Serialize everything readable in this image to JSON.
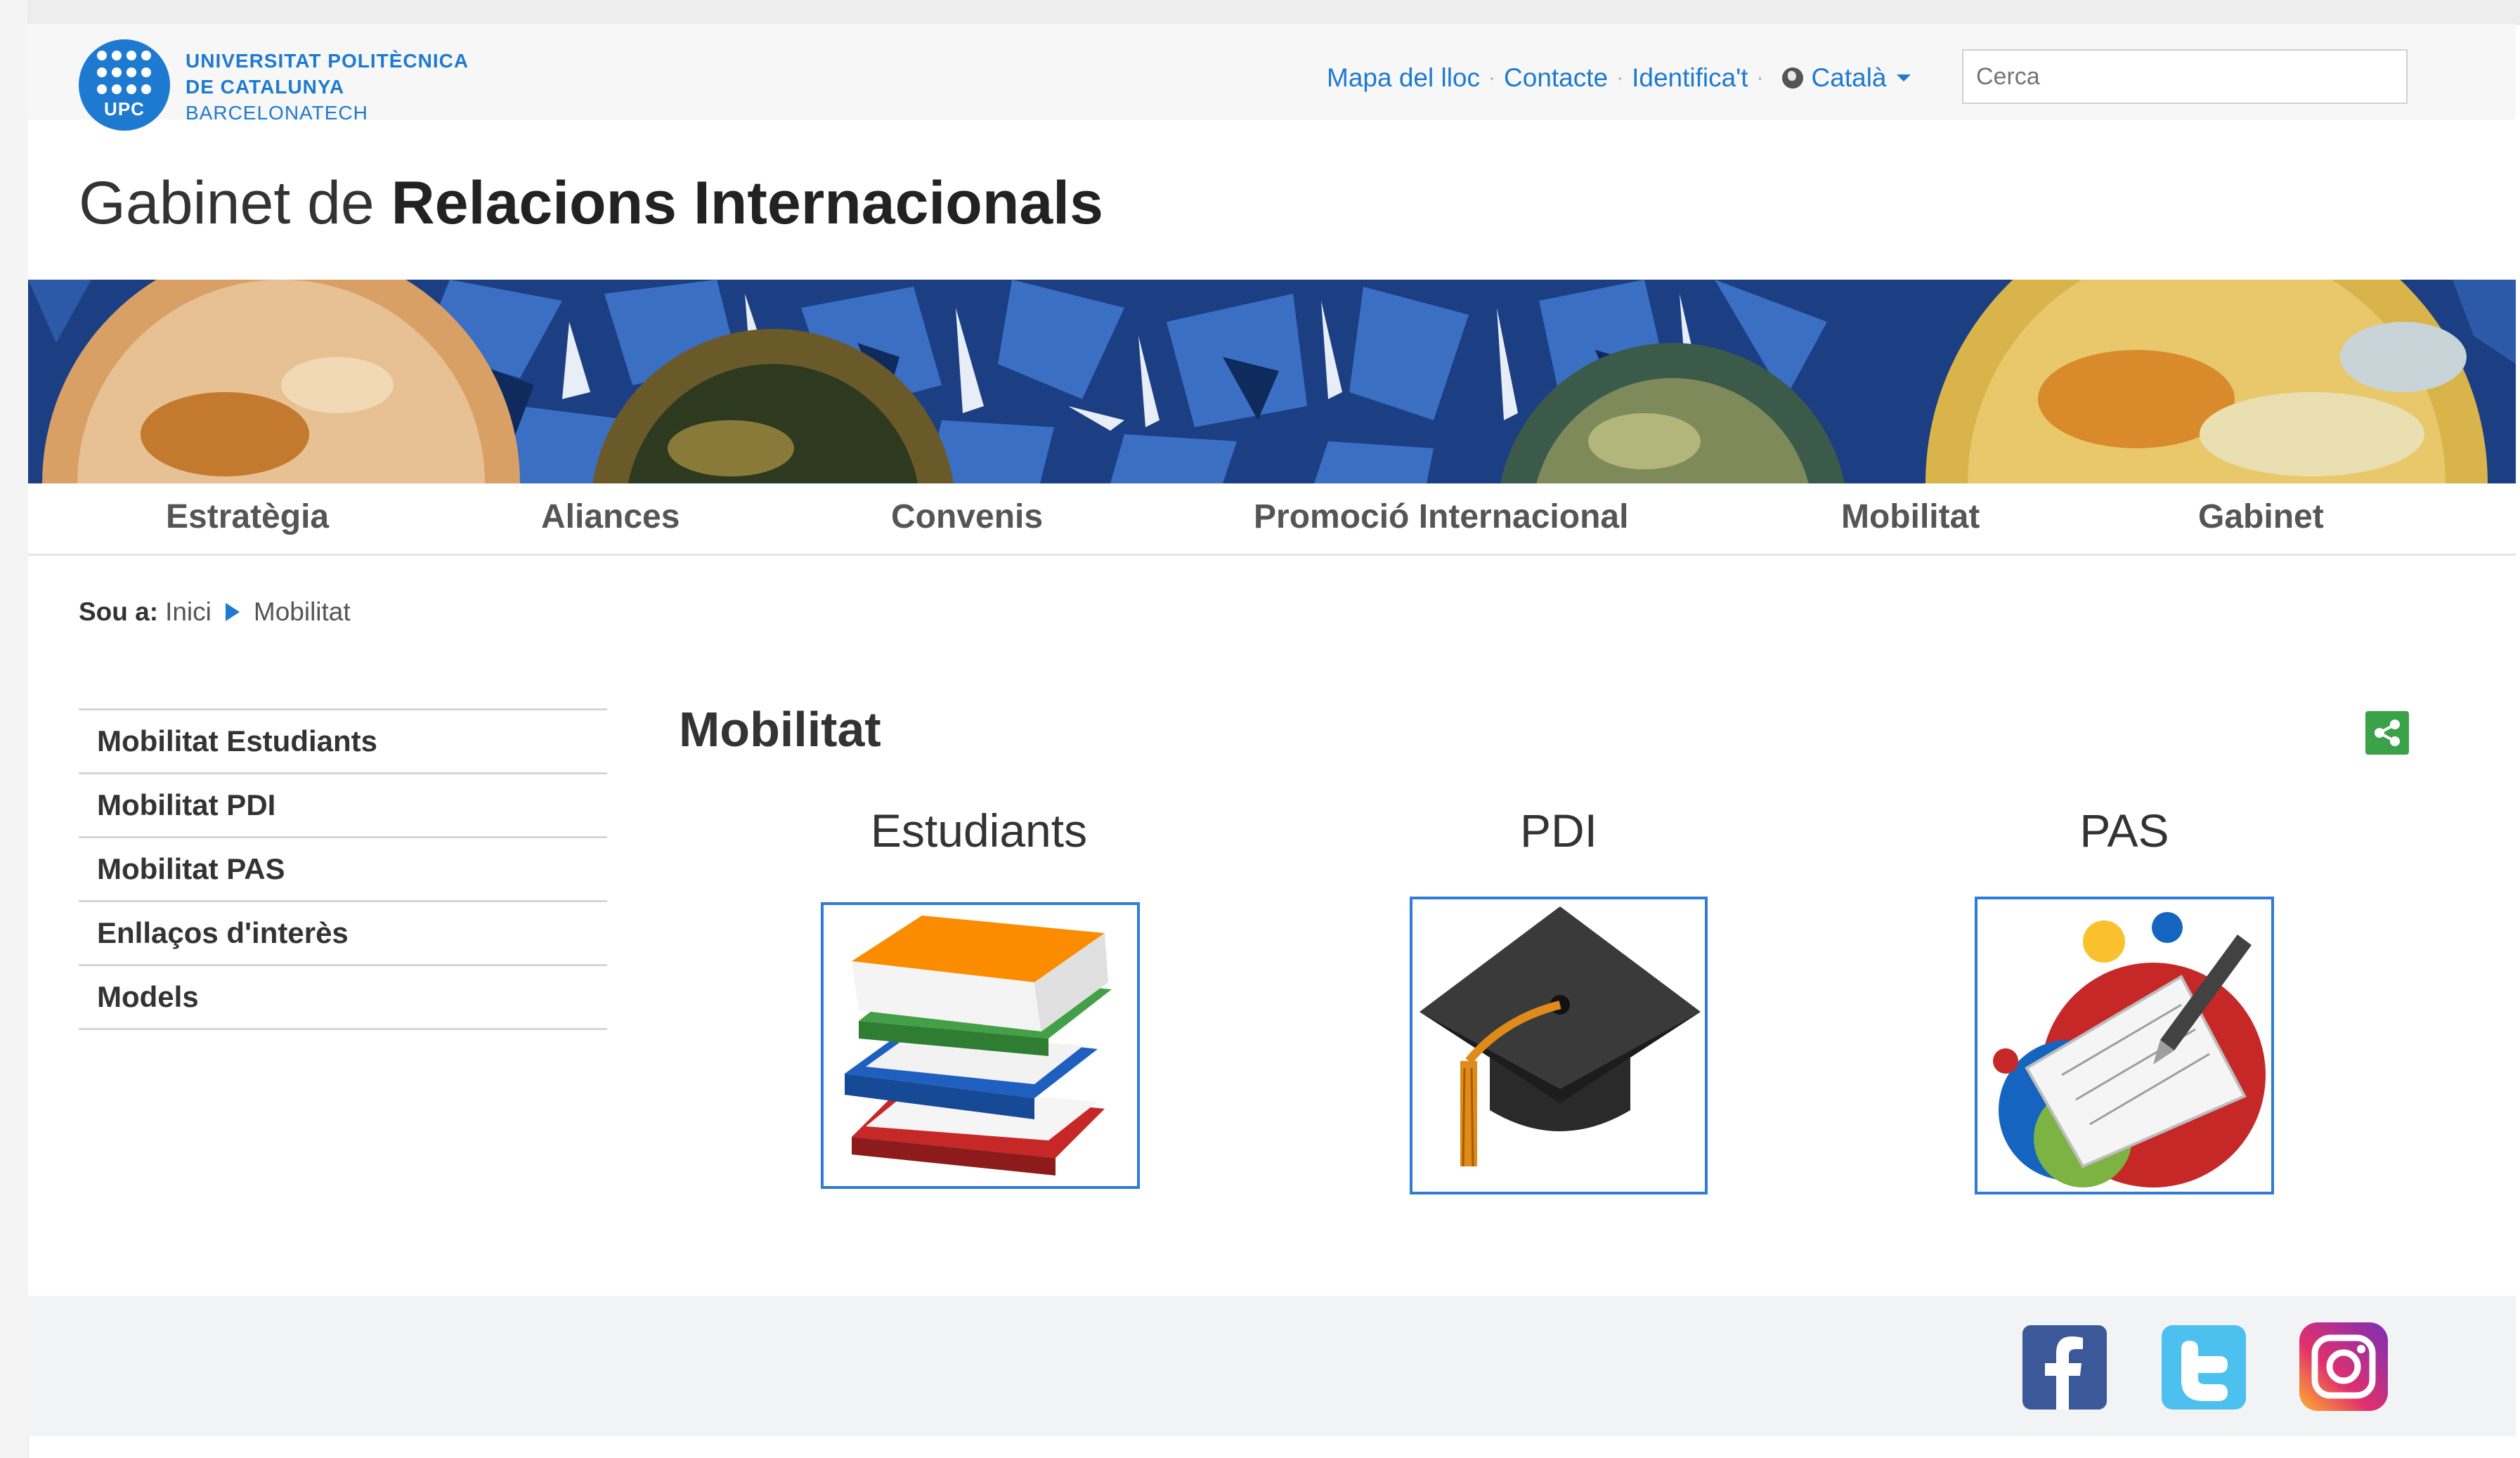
{
  "header": {
    "logo": {
      "badge": "UPC",
      "lines": [
        "UNIVERSITAT POLITÈCNICA",
        "DE CATALUNYA",
        "BARCELONATECH"
      ]
    },
    "utility_links": [
      "Mapa del lloc",
      "Contacte",
      "Identifica't"
    ],
    "language": "Català",
    "search_placeholder": "Cerca"
  },
  "site_title": {
    "prefix": "Gabinet de",
    "emphasis": "Relacions Internacionals"
  },
  "nav": [
    "Estratègia",
    "Aliances",
    "Convenis",
    "Promoció Internacional",
    "Mobilitat",
    "Gabinet"
  ],
  "breadcrumb": {
    "label": "Sou a:",
    "items": [
      "Inici",
      "Mobilitat"
    ]
  },
  "sidebar": [
    "Mobilitat Estudiants",
    "Mobilitat PDI",
    "Mobilitat PAS",
    "Enllaços d'interès",
    "Models"
  ],
  "main": {
    "title": "Mobilitat",
    "columns": [
      {
        "title": "Estudiants",
        "icon": "books-icon"
      },
      {
        "title": "PDI",
        "icon": "graduation-cap-icon"
      },
      {
        "title": "PAS",
        "icon": "notepad-pen-icon"
      }
    ]
  },
  "footer": {
    "social": [
      "facebook-icon",
      "twitter-icon",
      "instagram-icon"
    ]
  },
  "colors": {
    "brand": "#1e7ad0",
    "card_border": "#2f7bd8",
    "share": "#3aa34a"
  }
}
